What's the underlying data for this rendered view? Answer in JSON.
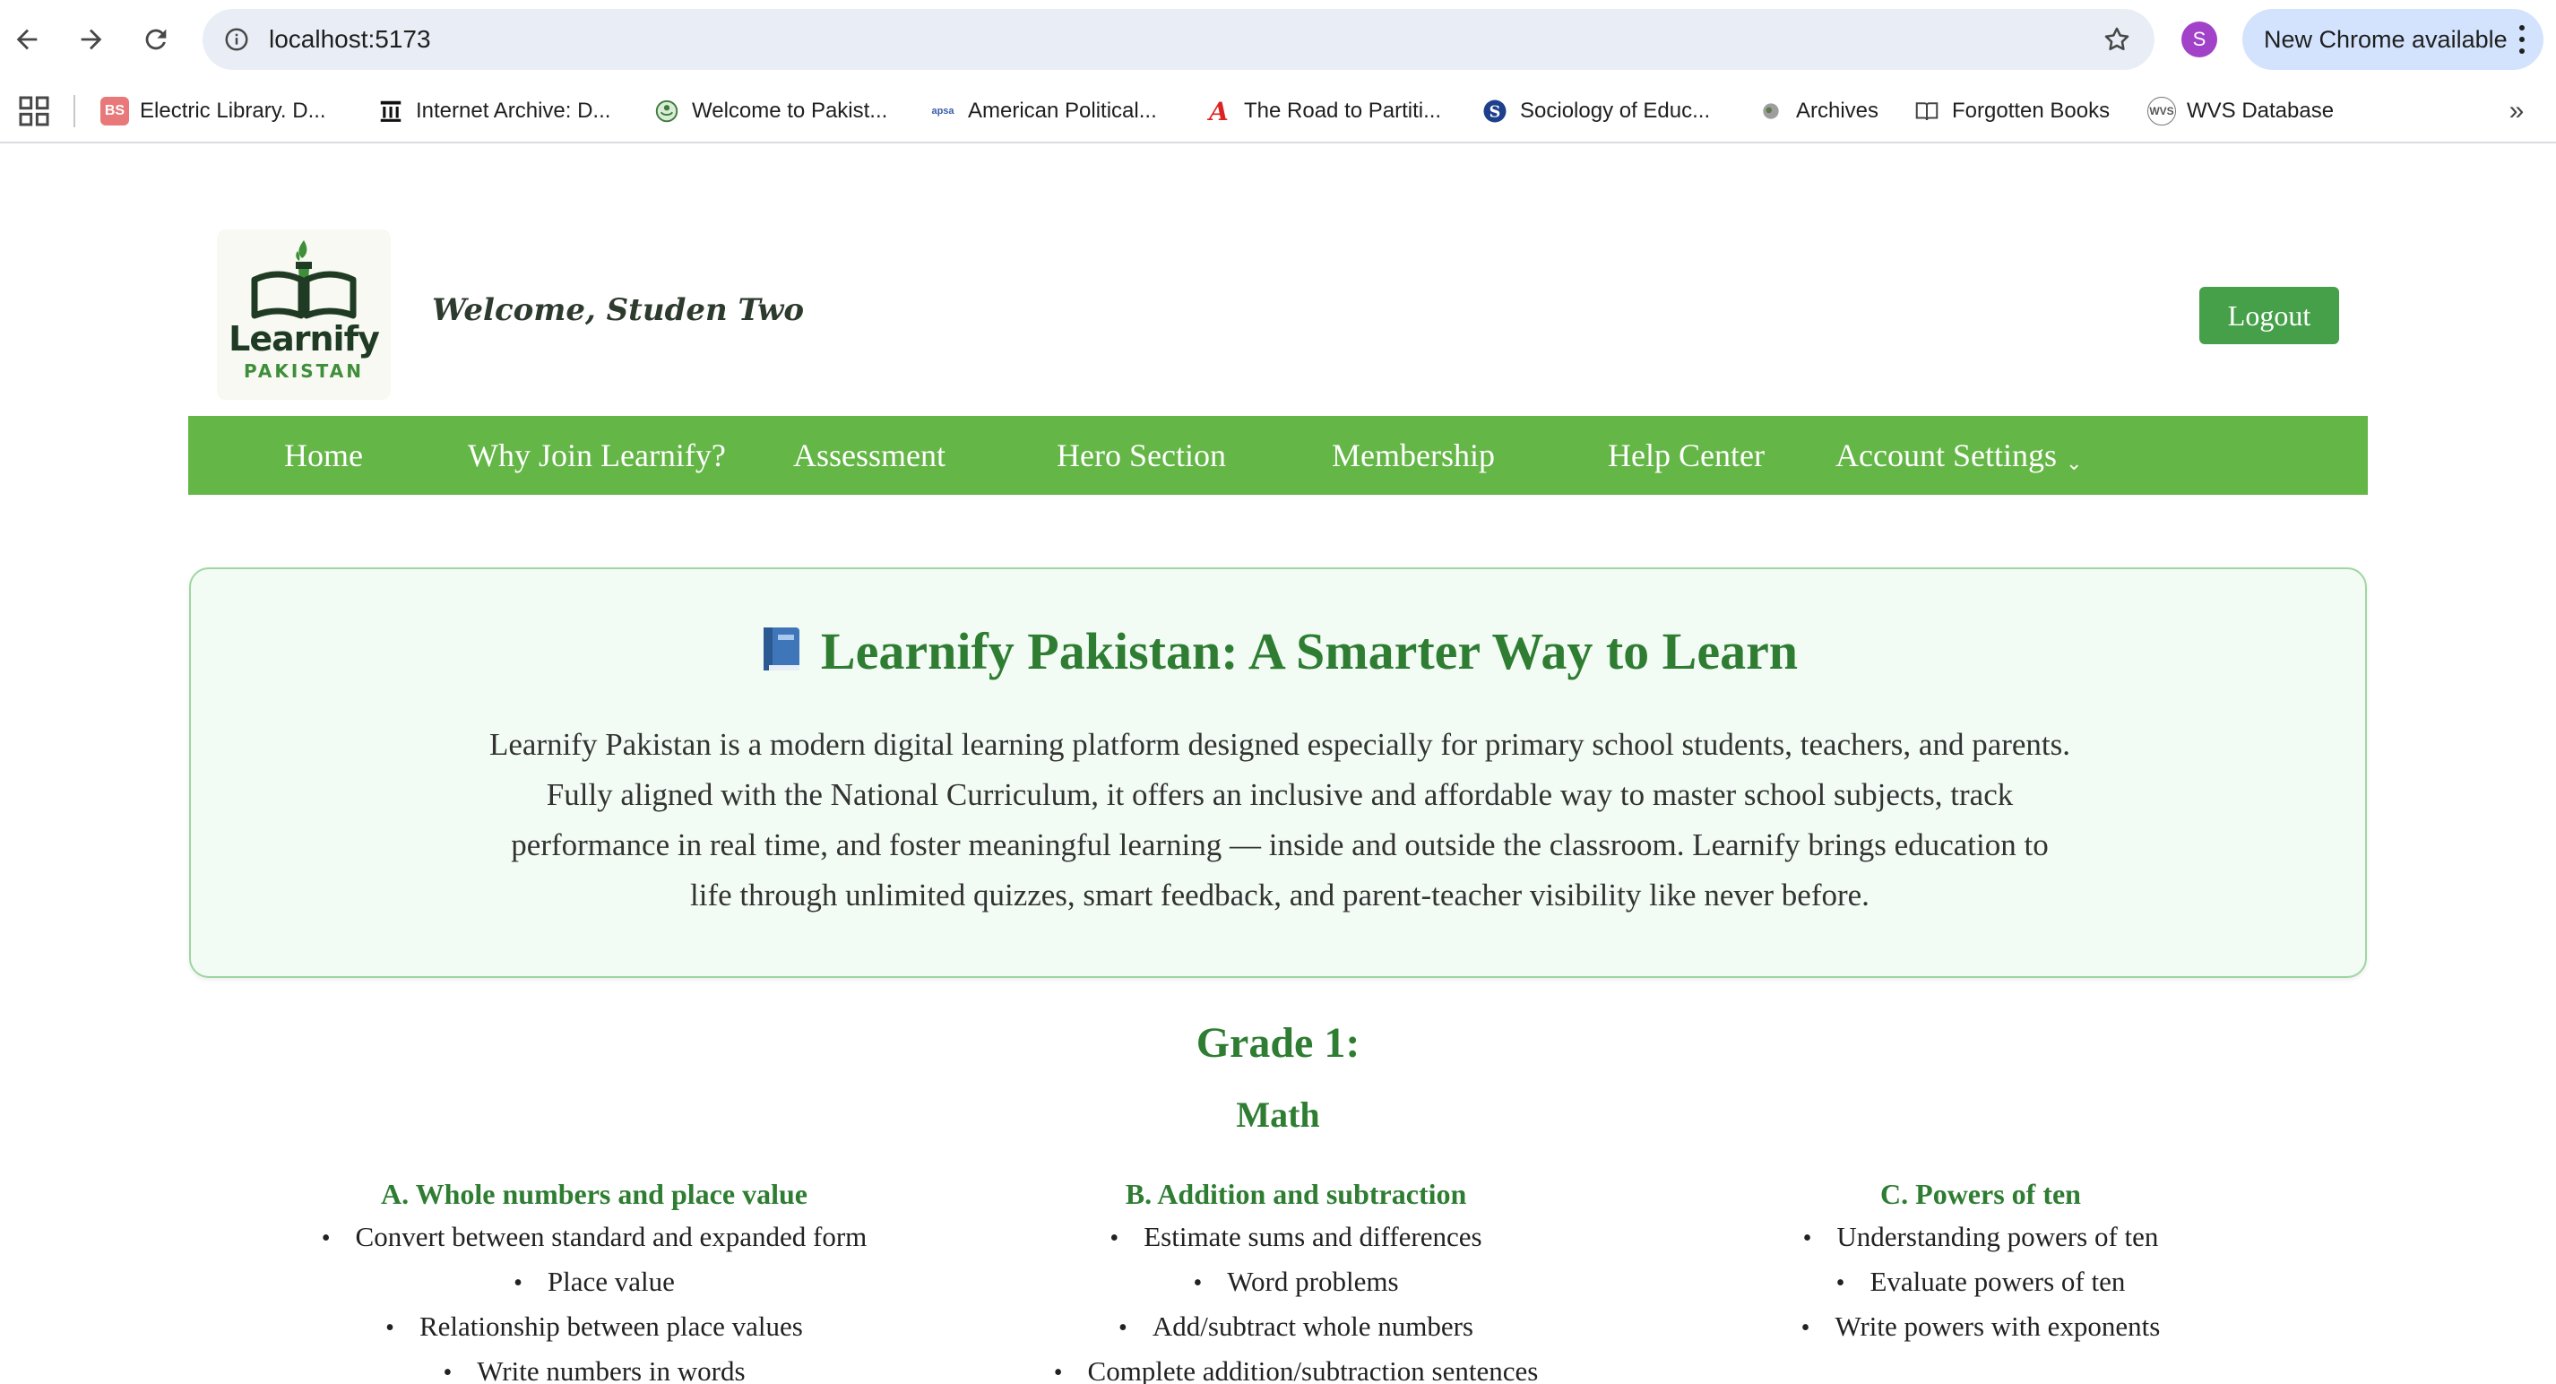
{
  "browser": {
    "url": "localhost:5173",
    "profile_initial": "S",
    "update_label": "New Chrome available",
    "bookmarks": [
      {
        "label": "Electric Library. D...",
        "icon": "bs-icon"
      },
      {
        "label": "Internet Archive: D...",
        "icon": "archive-icon"
      },
      {
        "label": "Welcome to Pakist...",
        "icon": "emblem-icon"
      },
      {
        "label": "American Political...",
        "icon": "apsa-icon"
      },
      {
        "label": "The Road to Partiti...",
        "icon": "script-a-icon"
      },
      {
        "label": "Sociology of Educ...",
        "icon": "s-circle-icon"
      },
      {
        "label": "Archives",
        "icon": "archives-icon"
      },
      {
        "label": "Forgotten Books",
        "icon": "book-icon"
      },
      {
        "label": "WVS Database",
        "icon": "wvs-icon"
      }
    ]
  },
  "header": {
    "logo_line1": "Learnify",
    "logo_line2": "PAKISTAN",
    "welcome": "Welcome, Studen Two",
    "logout": "Logout"
  },
  "nav": {
    "items": [
      "Home",
      "Why Join Learnify?",
      "Assessment",
      "Hero Section",
      "Membership",
      "Help Center",
      "Account Settings"
    ],
    "caret": "⌄"
  },
  "hero": {
    "title": "Learnify Pakistan: A Smarter Way to Learn",
    "description": "Learnify Pakistan is a modern digital learning platform designed especially for primary school students, teachers, and parents. Fully aligned with the National Curriculum, it offers an inclusive and affordable way to master school subjects, track performance in real time, and foster meaningful learning — inside and outside the classroom. Learnify brings education to life through unlimited quizzes, smart feedback, and parent-teacher visibility like never before."
  },
  "curriculum": {
    "grade": "Grade 1:",
    "subject": "Math",
    "topics": [
      {
        "title": "A. Whole numbers and place value",
        "items": [
          "Convert between standard and expanded form",
          "Place value",
          "Relationship between place values",
          "Write numbers in words"
        ]
      },
      {
        "title": "B. Addition and subtraction",
        "items": [
          "Estimate sums and differences",
          "Word problems",
          "Add/subtract whole numbers",
          "Complete addition/subtraction sentences"
        ]
      },
      {
        "title": "C. Powers of ten",
        "items": [
          "Understanding powers of ten",
          "Evaluate powers of ten",
          "Write powers with exponents"
        ]
      }
    ]
  },
  "colors": {
    "nav_green": "#64b646",
    "title_green": "#2e7d32",
    "button_green": "#45a049"
  }
}
